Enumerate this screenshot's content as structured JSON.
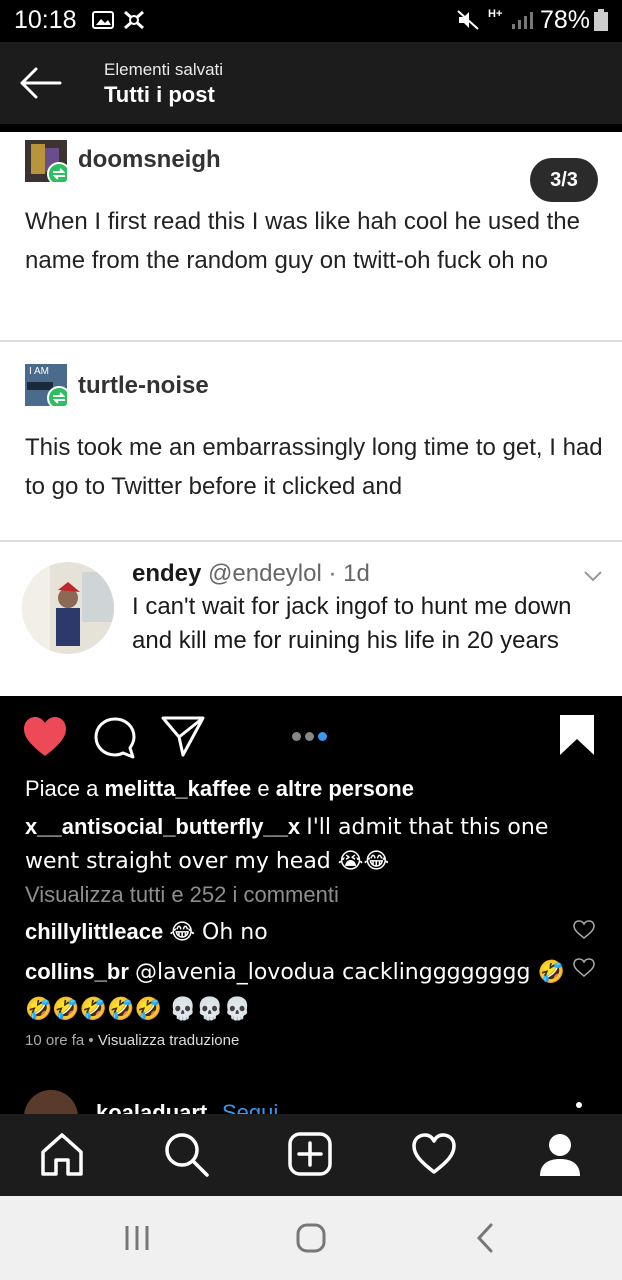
{
  "status_bar": {
    "time": "10:18",
    "battery": "78%",
    "signal_label": "H+"
  },
  "header": {
    "subtitle": "Elementi salvati",
    "title": "Tutti i post"
  },
  "post_image": {
    "counter": "3/3",
    "blocks": [
      {
        "username": "doomsneigh",
        "text": "When I first read this I was like hah cool he used the name from the random guy on twitt-oh fuck oh no"
      },
      {
        "username": "turtle-noise",
        "avatar_text": "I AM",
        "text": "This took me an embarrassingly long time to get, I had to go to Twitter before it clicked and"
      }
    ],
    "tweet": {
      "name": "endey",
      "handle": "@endeylol",
      "time": "· 1d",
      "text": "I can't wait for jack ingof to hunt me down and kill me for ruining his life in 20 years"
    }
  },
  "actions": {
    "carousel_total": 3,
    "carousel_active": 3
  },
  "likes": {
    "prefix": "Piace a",
    "user": "melitta_kaffee",
    "middle": "e",
    "rest": "altre persone"
  },
  "caption": {
    "user": "x__antisocial_butterfly__x",
    "text": "I'll admit that this one went straight over my head 😭😂"
  },
  "view_all_comments": "Visualizza tutti e 252 i commenti",
  "comments": [
    {
      "user": "chillylittleace",
      "text": "😂 Oh no"
    },
    {
      "user": "collins_br",
      "text": "@lavenia_lovodua cacklingggggggg 🤣🤣🤣🤣🤣🤣 💀💀💀"
    }
  ],
  "meta": {
    "time": "10 ore fa",
    "separator": "•",
    "translate": "Visualizza traduzione"
  },
  "next_post": {
    "username": "koaladuart",
    "follow": "Segui"
  },
  "colors": {
    "accent_blue": "#3897f0",
    "like_red": "#ed4956",
    "header_bg": "#1c1c1c"
  }
}
